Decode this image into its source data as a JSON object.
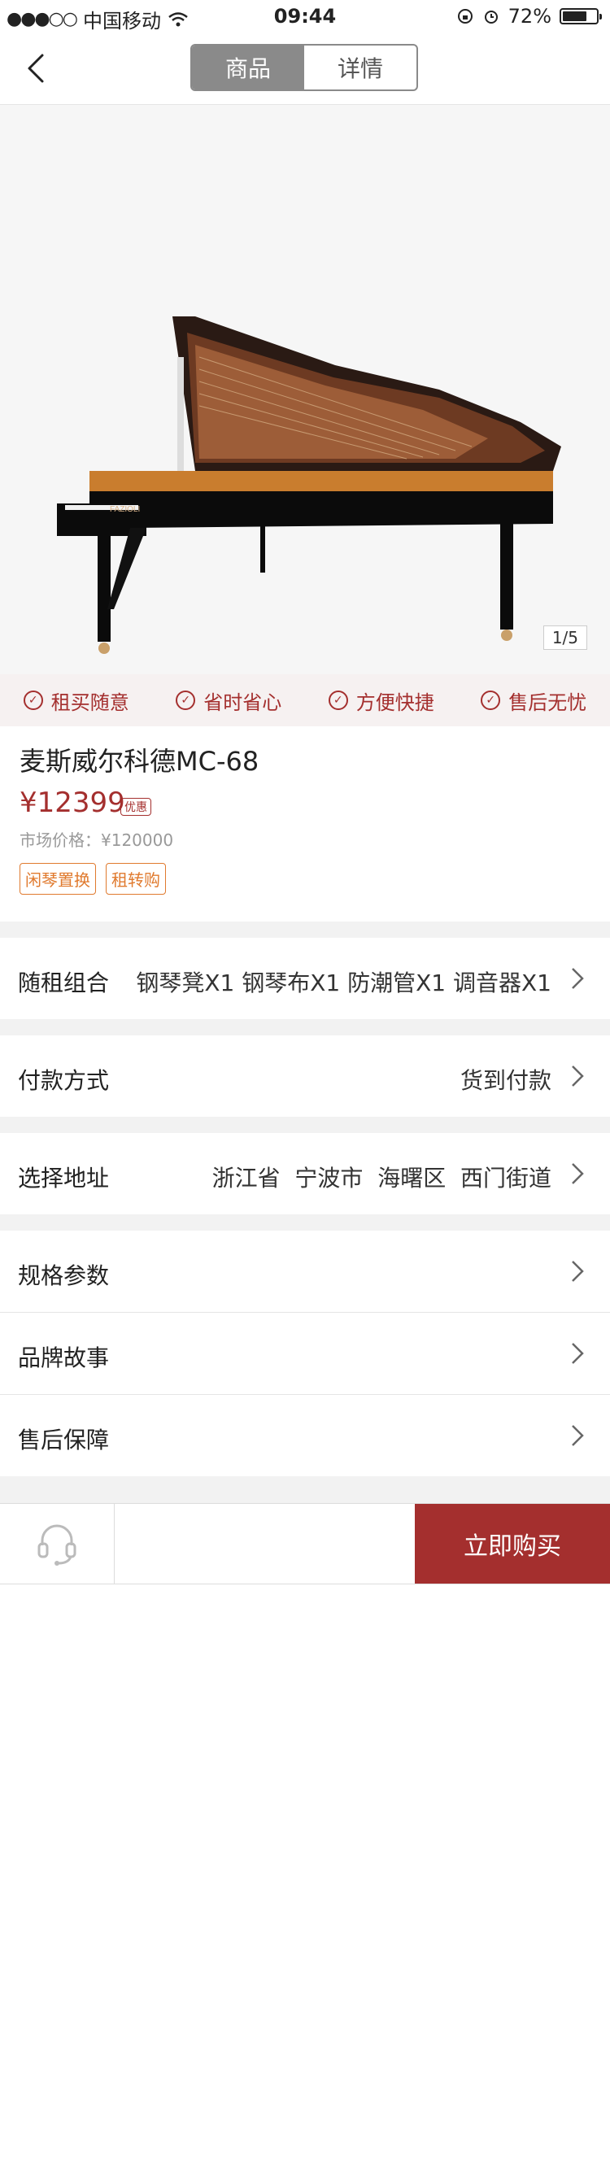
{
  "status_bar": {
    "carrier": "中国移动",
    "time": "09:44",
    "battery_percent": "72%",
    "battery_level": 0.72
  },
  "nav": {
    "tabs": [
      {
        "label": "商品",
        "active": true
      },
      {
        "label": "详情",
        "active": false
      }
    ],
    "back_icon": "chevron-left-icon"
  },
  "gallery": {
    "pager": "1/5",
    "brand_on_piano": "FAZIOLI"
  },
  "promises": [
    {
      "label": "租买随意"
    },
    {
      "label": "省时省心"
    },
    {
      "label": "方便快捷"
    },
    {
      "label": "售后无忧"
    }
  ],
  "product": {
    "title": "麦斯威尔科德MC-68",
    "price": "¥12399",
    "badge": "优惠",
    "market_price": "市场价格：¥120000",
    "tags": [
      "闲琴置换",
      "租转购"
    ]
  },
  "rows": [
    {
      "label": "随租组合",
      "value": "钢琴凳X1 钢琴布X1 防潮管X1 调音器X1"
    },
    {
      "label": "付款方式",
      "value": "货到付款"
    },
    {
      "label": "选择地址",
      "value": "浙江省  宁波市  海曙区  西门街道"
    },
    {
      "label": "规格参数",
      "value": ""
    },
    {
      "label": "品牌故事",
      "value": ""
    },
    {
      "label": "售后保障",
      "value": ""
    }
  ],
  "bottom": {
    "service_icon": "headset-icon",
    "buy_label": "立即购买"
  },
  "colors": {
    "accent": "#a42f2e",
    "tag_orange": "#e07a2e",
    "segment_active": "#8a8a8a"
  }
}
